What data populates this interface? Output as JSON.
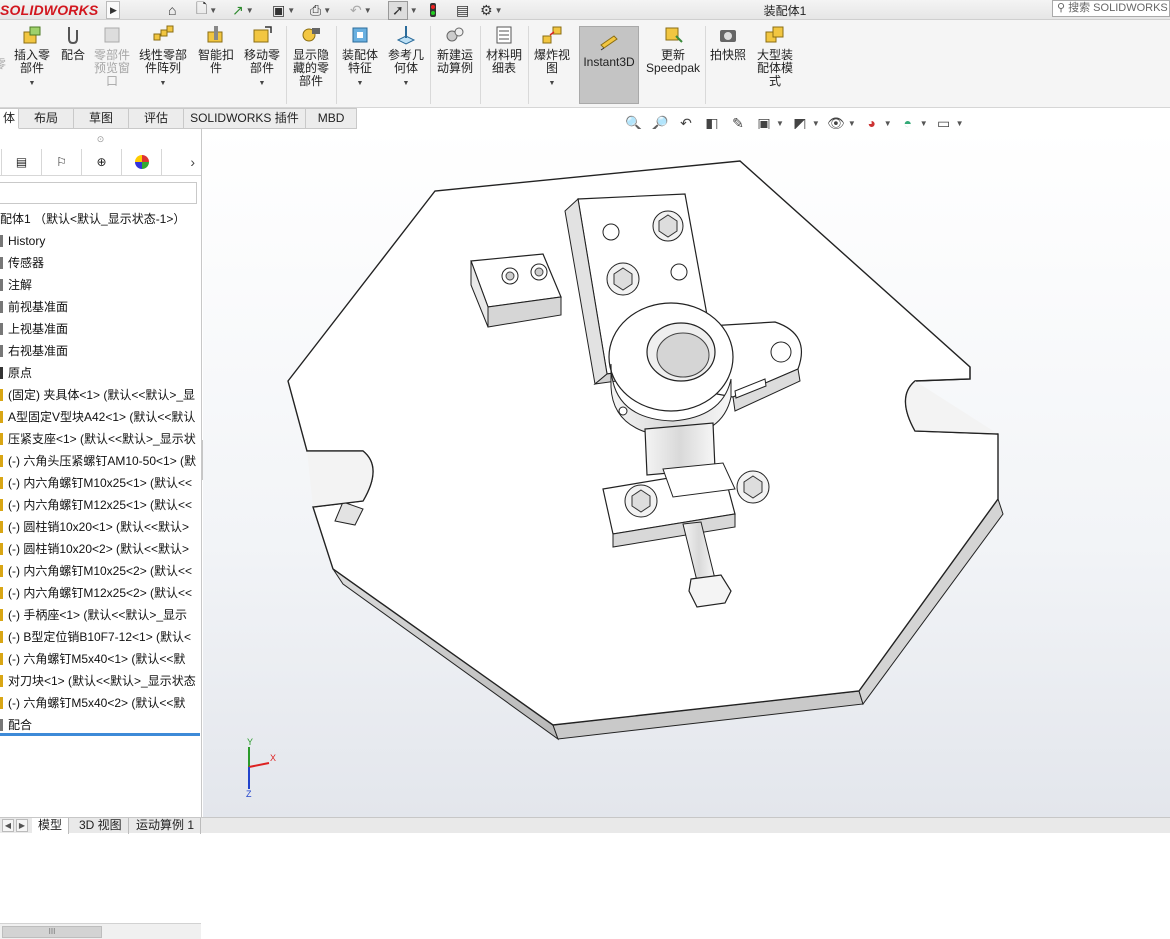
{
  "app": {
    "logo_text": "SOLIDWORKS",
    "document_title": "装配体1",
    "search_placeholder": "搜索 SOLIDWORKS"
  },
  "quick_access": {
    "icons": [
      "home-icon",
      "new-document-icon",
      "open-icon",
      "save-icon",
      "print-icon",
      "undo-icon",
      "select-icon",
      "rebuild-icon",
      "file-properties-icon",
      "options-icon"
    ]
  },
  "ribbon": {
    "buttons": [
      {
        "label": "插入零\n部件",
        "icon": "insert-component-icon",
        "enabled": true,
        "caret": true
      },
      {
        "label": "配合",
        "icon": "mate-icon",
        "enabled": true,
        "caret": false
      },
      {
        "label": "零部件\n预览窗\n口",
        "icon": "component-preview-icon",
        "enabled": false,
        "caret": false
      },
      {
        "label": "线性零部\n件阵列",
        "icon": "linear-pattern-icon",
        "enabled": true,
        "caret": true
      },
      {
        "label": "智能扣\n件",
        "icon": "smart-fastener-icon",
        "enabled": true,
        "caret": false
      },
      {
        "label": "移动零\n部件",
        "icon": "move-component-icon",
        "enabled": true,
        "caret": true
      },
      {
        "label": "显示隐\n藏的零\n部件",
        "icon": "show-hidden-icon",
        "enabled": true,
        "caret": false
      },
      {
        "label": "装配体\n特征",
        "icon": "assembly-feature-icon",
        "enabled": true,
        "caret": true
      },
      {
        "label": "参考几\n何体",
        "icon": "reference-geometry-icon",
        "enabled": true,
        "caret": true
      },
      {
        "label": "新建运\n动算例",
        "icon": "new-motion-study-icon",
        "enabled": true,
        "caret": false
      },
      {
        "label": "材料明\n细表",
        "icon": "bom-icon",
        "enabled": true,
        "caret": false
      },
      {
        "label": "爆炸视\n图",
        "icon": "exploded-view-icon",
        "enabled": true,
        "caret": true
      },
      {
        "label": "Instant3D",
        "icon": "instant3d-icon",
        "enabled": true,
        "caret": false,
        "active": true
      },
      {
        "label": "更新\nSpeedpak",
        "icon": "speedpak-icon",
        "enabled": true,
        "caret": false
      },
      {
        "label": "拍快照",
        "icon": "snapshot-icon",
        "enabled": true,
        "caret": false
      },
      {
        "label": "大型装\n配体模\n式",
        "icon": "large-assembly-icon",
        "enabled": true,
        "caret": false
      }
    ]
  },
  "command_tabs": [
    "体",
    "布局",
    "草图",
    "评估",
    "SOLIDWORKS 插件",
    "MBD"
  ],
  "view_toolbar_icons": [
    "zoom-to-fit-icon",
    "zoom-area-icon",
    "previous-view-icon",
    "section-view-icon",
    "dynamic-annotation-icon",
    "view-orientation-icon",
    "display-style-icon",
    "hide-show-icon",
    "edit-appearance-icon",
    "apply-scene-icon",
    "view-settings-icon"
  ],
  "feature_manager": {
    "tabs": [
      "property-manager-icon",
      "configuration-manager-icon",
      "dimxpert-icon",
      "display-manager-icon"
    ],
    "root": "配体1 （默认<默认_显示状态-1>）",
    "items": [
      {
        "label": "History",
        "icon": "history-icon"
      },
      {
        "label": "传感器",
        "icon": "sensor-icon"
      },
      {
        "label": "注解",
        "icon": "annotation-icon"
      },
      {
        "label": "前视基准面",
        "icon": "plane-icon"
      },
      {
        "label": "上视基准面",
        "icon": "plane-icon"
      },
      {
        "label": "右视基准面",
        "icon": "plane-icon"
      },
      {
        "label": "原点",
        "icon": "origin-icon"
      },
      {
        "label": "(固定) 夹具体<1> (默认<<默认>_显",
        "icon": "part-icon"
      },
      {
        "label": "A型固定V型块A42<1> (默认<<默认",
        "icon": "part-icon"
      },
      {
        "label": "压紧支座<1> (默认<<默认>_显示状",
        "icon": "part-icon"
      },
      {
        "label": "(-) 六角头压紧螺钉AM10-50<1> (默",
        "icon": "part-icon"
      },
      {
        "label": "(-) 内六角螺钉M10x25<1> (默认<<",
        "icon": "part-icon"
      },
      {
        "label": "(-) 内六角螺钉M12x25<1> (默认<<",
        "icon": "part-icon"
      },
      {
        "label": "(-) 圆柱销10x20<1> (默认<<默认>",
        "icon": "part-icon"
      },
      {
        "label": "(-) 圆柱销10x20<2> (默认<<默认>",
        "icon": "part-icon"
      },
      {
        "label": "(-) 内六角螺钉M10x25<2> (默认<<",
        "icon": "part-icon"
      },
      {
        "label": "(-) 内六角螺钉M12x25<2> (默认<<",
        "icon": "part-icon"
      },
      {
        "label": "(-) 手柄座<1> (默认<<默认>_显示",
        "icon": "part-icon"
      },
      {
        "label": "(-) B型定位销B10F7-12<1> (默认<",
        "icon": "part-icon"
      },
      {
        "label": "(-) 六角螺钉M5x40<1> (默认<<默",
        "icon": "part-icon"
      },
      {
        "label": "对刀块<1> (默认<<默认>_显示状态",
        "icon": "part-icon"
      },
      {
        "label": "(-) 六角螺钉M5x40<2> (默认<<默",
        "icon": "part-icon"
      },
      {
        "label": "配合",
        "icon": "mates-folder-icon"
      }
    ],
    "scroll_thumb": "III"
  },
  "triad": {
    "x": "X",
    "y": "Y",
    "z": "Z"
  },
  "bottom_tabs": [
    "模型",
    "3D 视图",
    "运动算例 1"
  ]
}
